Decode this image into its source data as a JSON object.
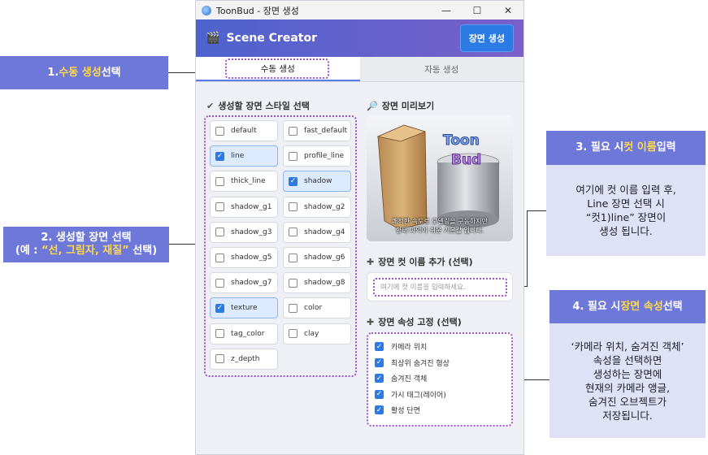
{
  "window": {
    "title": "ToonBud - 장면 생성",
    "minimize": "—",
    "maximize": "☐",
    "close": "✕"
  },
  "header": {
    "title": "Scene Creator",
    "generate_button": "장면 생성"
  },
  "tabs": [
    {
      "label": "수동 생성",
      "active": true
    },
    {
      "label": "자동 생성",
      "active": false
    }
  ],
  "styles_section": {
    "title": "생성할 장면 스타일 선택",
    "items": [
      {
        "label": "default",
        "checked": false
      },
      {
        "label": "fast_default",
        "checked": false
      },
      {
        "label": "line",
        "checked": true
      },
      {
        "label": "profile_line",
        "checked": false
      },
      {
        "label": "thick_line",
        "checked": false
      },
      {
        "label": "shadow",
        "checked": true
      },
      {
        "label": "shadow_g1",
        "checked": false
      },
      {
        "label": "shadow_g2",
        "checked": false
      },
      {
        "label": "shadow_g3",
        "checked": false
      },
      {
        "label": "shadow_g4",
        "checked": false
      },
      {
        "label": "shadow_g5",
        "checked": false
      },
      {
        "label": "shadow_g6",
        "checked": false
      },
      {
        "label": "shadow_g7",
        "checked": false
      },
      {
        "label": "shadow_g8",
        "checked": false
      },
      {
        "label": "texture",
        "checked": true
      },
      {
        "label": "color",
        "checked": false
      },
      {
        "label": "tag_color",
        "checked": false
      },
      {
        "label": "clay",
        "checked": false
      },
      {
        "label": "z_depth",
        "checked": false
      }
    ]
  },
  "preview_section": {
    "title": "장면 미리보기",
    "caption_line1": "쾌적한 속도로 모델링을 구동하지만",
    "caption_line2": "형태 파악이 쉬운 기본값 입니다.",
    "logo_line1": "Toon",
    "logo_line2": "Bud"
  },
  "cut_name_section": {
    "title": "장면 컷 이름 추가 (선택)",
    "placeholder": "여기에 컷 이름을 입력하세요."
  },
  "attributes_section": {
    "title": "장면 속성 고정 (선택)",
    "items": [
      {
        "label": "카메라 위치",
        "checked": true
      },
      {
        "label": "최상위 숨겨진 형상",
        "checked": true
      },
      {
        "label": "숨겨진 객체",
        "checked": true
      },
      {
        "label": "가시 태그(레이어)",
        "checked": true
      },
      {
        "label": "활성 단면",
        "checked": true
      }
    ]
  },
  "annotations": {
    "step1": {
      "prefix": "1. ",
      "highlight": "수동 생성",
      "suffix": " 선택"
    },
    "step2": {
      "line1": "2. 생성할 장면 선택",
      "line2_prefix": "(예 : ",
      "line2_highlight": "“선, 그림자, 재질”",
      "line2_suffix": " 선택)"
    },
    "step3": {
      "prefix": "3. 필요 시 ",
      "highlight": "컷 이름",
      "suffix": " 입력",
      "body": [
        "여기에 컷 이름 입력 후,",
        "Line 장면 선택 시",
        "“컷1)line” 장면이",
        "생성 됩니다."
      ]
    },
    "step4": {
      "prefix": "4. 필요 시 ",
      "highlight": "장면 속성",
      "suffix": " 선택",
      "body": [
        "‘카메라 위치, 숨겨진 객체’",
        "속성을 선택하면",
        "생성하는 장면에",
        "현재의 카메라 앵글,",
        "숨겨진 오브젝트가",
        "저장됩니다."
      ]
    }
  },
  "colors": {
    "callout": "#6e78d9",
    "callout_highlight": "#ffd84d",
    "callout_body": "#dfe1f6",
    "header_gradient_start": "#4d63cf",
    "header_gradient_end": "#7a5fc9",
    "accent": "#2c7be5",
    "dotted_outline": "#9b55c9"
  }
}
